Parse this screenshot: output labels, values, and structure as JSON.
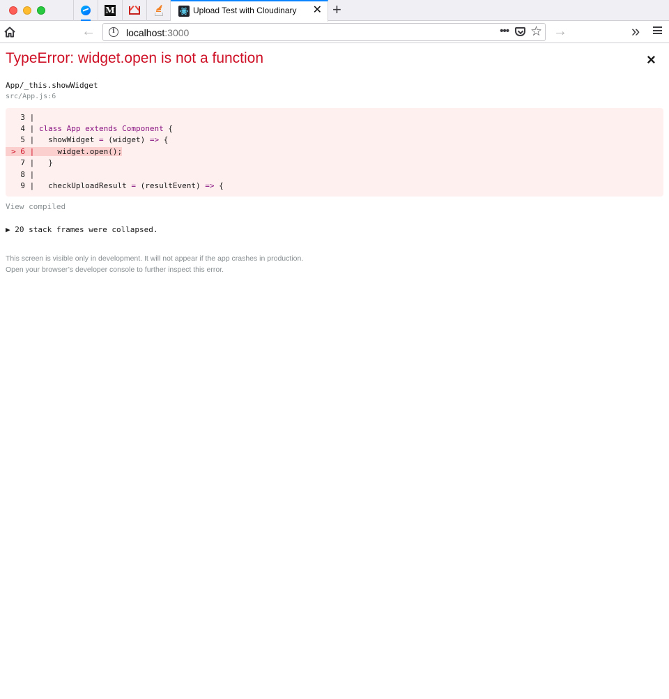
{
  "browser": {
    "tabs": {
      "pinned": [
        {
          "icon": "messenger-icon",
          "active": false
        },
        {
          "icon": "medium-icon",
          "label": "M"
        },
        {
          "icon": "gmail-icon"
        },
        {
          "icon": "stackoverflow-icon"
        }
      ],
      "active_title": "Upload Test with Cloudinary",
      "close_glyph": "✕",
      "new_tab_glyph": "+"
    },
    "nav": {
      "back_glyph": "←",
      "forward_glyph": "→",
      "url_host": "localhost",
      "url_port": ":3000",
      "page_actions_glyph": "•••",
      "star_glyph": "☆",
      "overflow_glyph": "»",
      "info_glyph": "i"
    },
    "colors": {
      "tab_accent": "#0a84ff",
      "error_red": "#ce1126",
      "code_bg": "#fff0f0",
      "highlight_bg": "#fccfcf",
      "keyword": "#881280"
    }
  },
  "error": {
    "title": "TypeError: widget.open is not a function",
    "close_glyph": "×",
    "frame_name": "App/_this.showWidget",
    "frame_file": "src/App.js:6",
    "code_lines": [
      {
        "marker": "",
        "num": "3",
        "highlighted": false
      },
      {
        "marker": "",
        "num": "4",
        "highlighted": false
      },
      {
        "marker": "",
        "num": "5",
        "highlighted": false
      },
      {
        "marker": ">",
        "num": "6",
        "highlighted": true
      },
      {
        "marker": "",
        "num": "7",
        "highlighted": false
      },
      {
        "marker": "",
        "num": "8",
        "highlighted": false
      },
      {
        "marker": "",
        "num": "9",
        "highlighted": false
      }
    ],
    "code": {
      "l4_kw1": "class",
      "l4_cls": "App",
      "l4_kw2": "extends",
      "l4_cls2": "Component",
      "l4_rest": " {",
      "l5_a": "  showWidget ",
      "l5_op1": "=",
      "l5_b": " (widget) ",
      "l5_op2": "=>",
      "l5_c": " {",
      "l6_text": "    widget.open();",
      "l7_text": "  }",
      "l9_a": "  checkUploadResult ",
      "l9_op1": "=",
      "l9_b": " (resultEvent) ",
      "l9_op2": "=>",
      "l9_c": " {"
    },
    "view_compiled": "View compiled",
    "collapsed_text": "▶ 20 stack frames were collapsed.",
    "footer_line1": "This screen is visible only in development. It will not appear if the app crashes in production.",
    "footer_line2": "Open your browser’s developer console to further inspect this error."
  }
}
